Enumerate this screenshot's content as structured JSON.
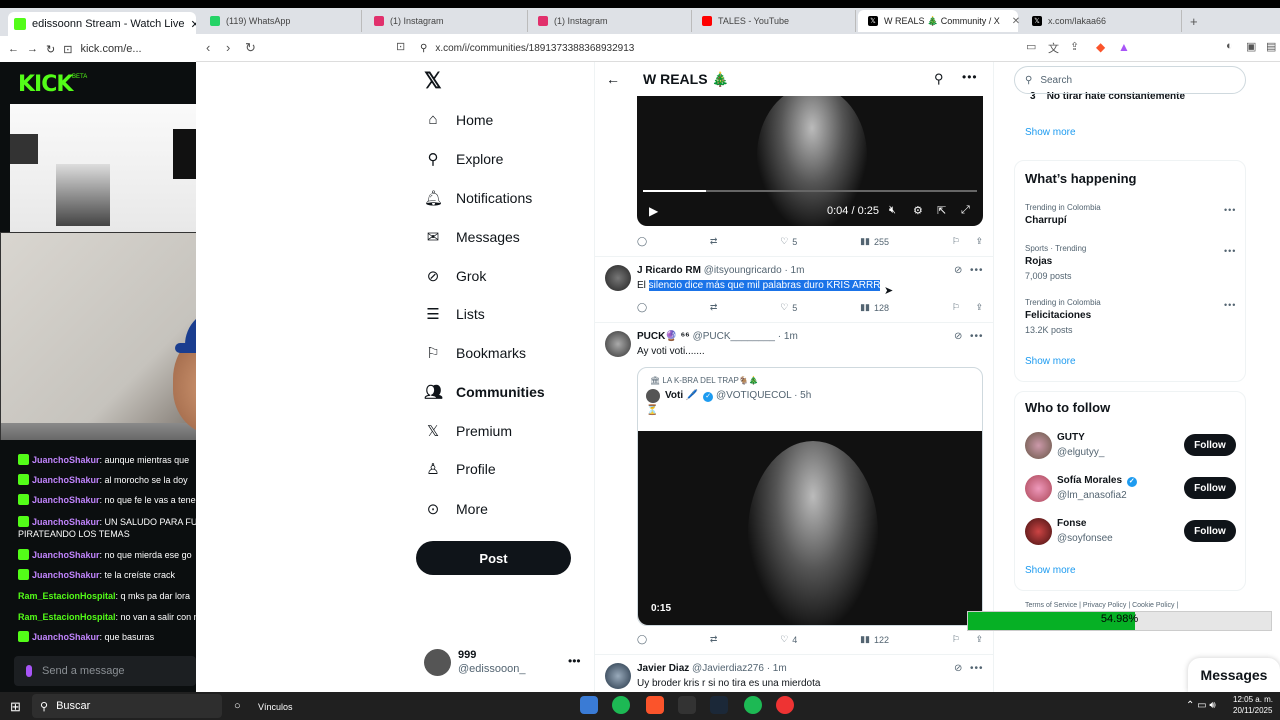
{
  "left_browser": {
    "tab_title": "edissoonn Stream - Watch Live",
    "url": "kick.com/e...",
    "logo": "KICK",
    "beta": "BETA"
  },
  "chat": {
    "lines": [
      {
        "user": "JuanchoShakur",
        "text": ": aunque mientras que"
      },
      {
        "user": "JuanchoShakur",
        "text": ": al morocho se la doy"
      },
      {
        "user": "JuanchoShakur",
        "text": ": no que fe le vas a tener"
      },
      {
        "user": "JuanchoShakur",
        "text": ": UN SALUDO PARA FU"
      },
      {
        "user": "",
        "text": "PIRATEANDO LOS TEMAS"
      },
      {
        "user": "JuanchoShakur",
        "text": ": no que mierda ese go"
      },
      {
        "user": "JuanchoShakur",
        "text": ": te la creíste crack"
      },
      {
        "user": "Ram_EstacionHospital",
        "text": ": q mks pa dar lora"
      },
      {
        "user": "Ram_EstacionHospital",
        "text": ": no van a salir con n"
      },
      {
        "user": "JuanchoShakur",
        "text": ": que basuras"
      }
    ],
    "input_placeholder": "Send a message"
  },
  "browser_tabs": [
    {
      "label": "(119) WhatsApp",
      "color": "#25d366"
    },
    {
      "label": "(1) Instagram",
      "color": "#e1306c"
    },
    {
      "label": "(1) Instagram",
      "color": "#e1306c"
    },
    {
      "label": "TALES - YouTube",
      "color": "#ff0000"
    },
    {
      "label": "W REALS 🎄 Community / X",
      "color": "#000000"
    },
    {
      "label": "x.com/lakaa66",
      "color": "#000000"
    }
  ],
  "address_bar": {
    "url": "x.com/i/communities/1891373388368932913"
  },
  "x_nav": {
    "items": [
      {
        "label": "Home",
        "icon": "home-icon"
      },
      {
        "label": "Explore",
        "icon": "search-icon"
      },
      {
        "label": "Notifications",
        "icon": "bell-icon"
      },
      {
        "label": "Messages",
        "icon": "mail-icon"
      },
      {
        "label": "Grok",
        "icon": "grok-icon"
      },
      {
        "label": "Lists",
        "icon": "list-icon"
      },
      {
        "label": "Bookmarks",
        "icon": "bookmark-icon"
      },
      {
        "label": "Communities",
        "icon": "communities-icon"
      },
      {
        "label": "Premium",
        "icon": "x-logo-icon"
      },
      {
        "label": "Profile",
        "icon": "person-icon"
      },
      {
        "label": "More",
        "icon": "more-icon"
      }
    ],
    "post_button": "Post",
    "account": {
      "name": "999",
      "handle": "@edissooon_"
    }
  },
  "community": {
    "title": "W REALS 🎄"
  },
  "video1": {
    "time": "0:04 / 0:25",
    "progress": 0.19
  },
  "tweet1_actions": {
    "replies": "",
    "retweets": "",
    "likes": "5",
    "views": "255"
  },
  "tweet2": {
    "name": "J Ricardo RM",
    "handle": "@itsyoungricardo",
    "time": "· 1m",
    "text_pre": "El ",
    "text_highlight": "silencio dice más que mil palabras duro KRIS ARRR",
    "likes": "5",
    "views": "128"
  },
  "tweet3": {
    "name": "PUCK🔮 ⁶⁶",
    "handle": "@PUCK________",
    "time": "· 1m",
    "text": "Ay voti voti.......",
    "quote": {
      "community": "🏛 LA K-BRA DEL TRAP🐐🎄",
      "name": "Voti 🖊️",
      "handle": "@VOTIQUECOL",
      "time": "· 5h",
      "text": "⏳",
      "video_time": "0:15"
    },
    "likes": "4",
    "views": "122"
  },
  "tweet4": {
    "name": "Javier Diaz",
    "handle": "@Javierdiaz276",
    "time": "· 1m",
    "text": "Uy broder kris r si no tira es una mierdota"
  },
  "sidebar": {
    "search_placeholder": "Search",
    "top_partial": "No tirar hate constantemente",
    "top_partial_num": "3",
    "show_more": "Show more",
    "happening_title": "What’s happening",
    "trends": [
      {
        "context": "Trending in Colombia",
        "name": "Charrupí",
        "posts": ""
      },
      {
        "context": "Sports · Trending",
        "name": "Rojas",
        "posts": "7,009 posts"
      },
      {
        "context": "Trending in Colombia",
        "name": "Felicitaciones",
        "posts": "13.2K posts"
      }
    ],
    "who_title": "Who to follow",
    "follow_label": "Follow",
    "follows": [
      {
        "name": "GUTY",
        "handle": "@elgutyy_"
      },
      {
        "name": "Sofía Morales",
        "handle": "@lm_anasofia2"
      },
      {
        "name": "Fonse",
        "handle": "@soyfonsee"
      }
    ],
    "footer": "Terms of Service  |  Privacy Policy  |  Cookie Policy  |"
  },
  "progress_overlay": {
    "value": 0.5498,
    "label": "54.98%"
  },
  "messages_drawer": "Messages",
  "taskbar": {
    "search": "Buscar",
    "links": "Vínculos",
    "time": "12:05 a. m.",
    "date": "20/11/2025"
  }
}
